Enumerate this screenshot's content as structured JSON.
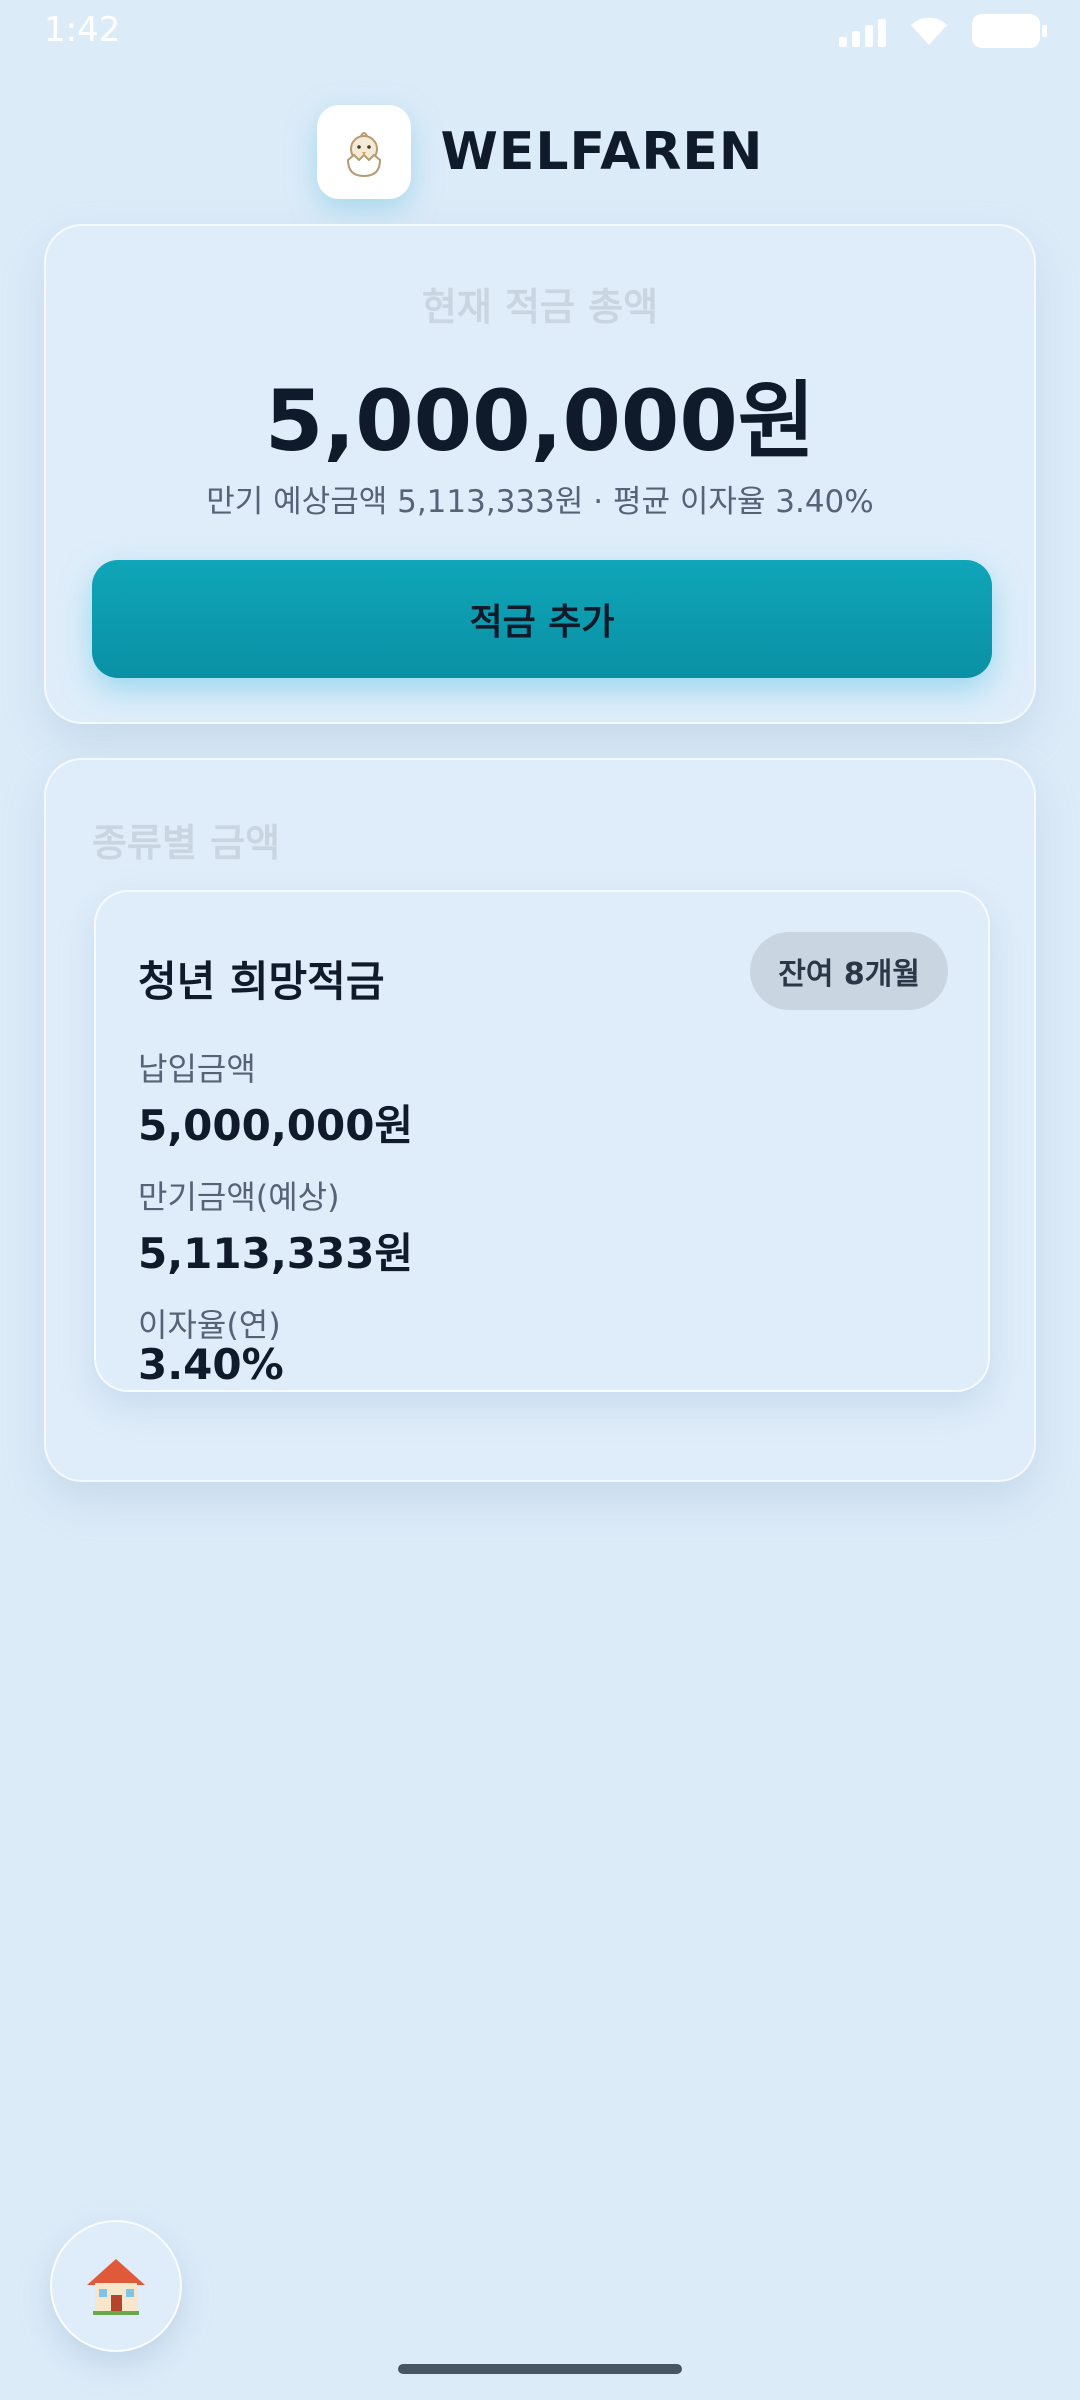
{
  "status_bar": {
    "time": "1:42"
  },
  "header": {
    "logo_icon": "chick-in-egg-icon",
    "title": "WELFAREN"
  },
  "summary": {
    "label": "현재 적금 총액",
    "amount": "5,000,000원",
    "subtitle": "만기 예상금액 5,113,333원 · 평균 이자율 3.40%",
    "add_button_label": "적금 추가"
  },
  "types": {
    "label": "종류별 금액",
    "products": [
      {
        "name": "청년 희망적금",
        "badge": "잔여 8개월",
        "fields": [
          {
            "label": "납입금액",
            "value": "5,000,000원"
          },
          {
            "label": "만기금액(예상)",
            "value": "5,113,333원"
          },
          {
            "label": "이자율(연)",
            "value": "3.40%"
          }
        ]
      }
    ]
  },
  "nav": {
    "home_icon": "house-icon"
  },
  "colors": {
    "background": "#dcebf8",
    "accent": "#0fa6b8",
    "text_primary": "#0f1a2a",
    "text_secondary": "#566377",
    "muted_label": "#c9d6e2"
  }
}
